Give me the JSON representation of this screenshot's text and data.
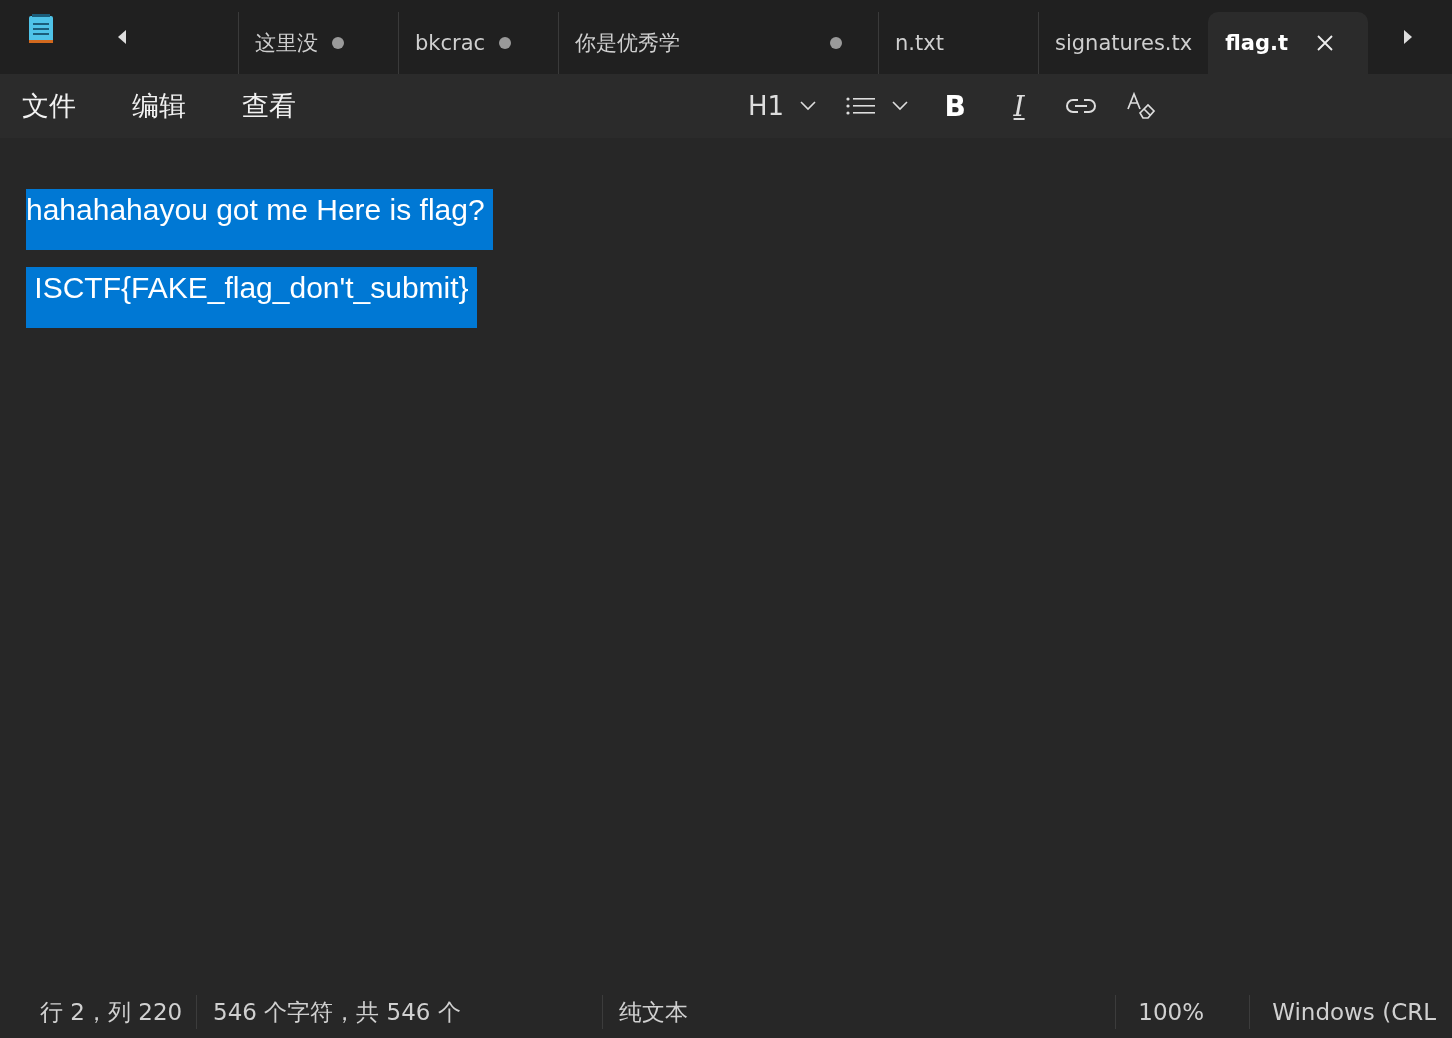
{
  "tabs": [
    {
      "label": "这里没",
      "modified": true,
      "selected": false
    },
    {
      "label": "bkcrac",
      "modified": true,
      "selected": false
    },
    {
      "label": "你是优秀学",
      "modified": true,
      "selected": false,
      "kind": "wide"
    },
    {
      "label": "n.txt",
      "modified": false,
      "selected": false
    },
    {
      "label": "signatures.tx",
      "modified": false,
      "selected": false
    },
    {
      "label": "flag.t",
      "modified": false,
      "selected": true
    }
  ],
  "menu": [
    "文件",
    "编辑",
    "查看"
  ],
  "toolbar": [
    {
      "kind": "heading",
      "label": "H1"
    },
    {
      "kind": "list"
    },
    {
      "kind": "bold",
      "label": "B"
    },
    {
      "kind": "italic",
      "label": "I"
    },
    {
      "kind": "link"
    },
    {
      "kind": "clear-format"
    }
  ],
  "lines": [
    {
      "text": "hahahahayou got me Here is flag?",
      "selected": true
    },
    {
      "text": " ISCTF{FAKE_flag_don't_submit}",
      "selected": true
    }
  ],
  "status_bar": [
    "行 2，列 220",
    "546 个字符，共 546 个",
    "纯文本",
    "100%",
    "Windows (CRL"
  ]
}
